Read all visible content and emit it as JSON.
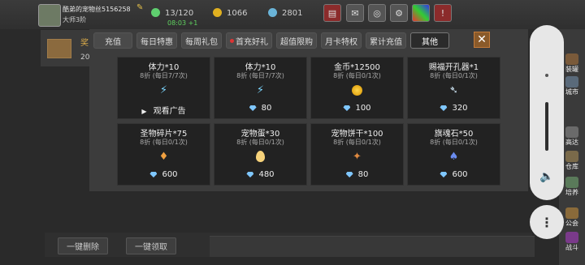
{
  "header": {
    "player_name": "酷弟的宠物丝5156258",
    "rank": "大师3阶",
    "stats": [
      {
        "icon": "stamina-icon",
        "value": "13/120",
        "color": "#5fcf6f"
      },
      {
        "icon": "gold-icon",
        "value": "1066",
        "color": "#e0b020"
      },
      {
        "icon": "gem-icon",
        "value": "2801",
        "color": "#6ab4d8"
      }
    ],
    "timer": "08:03 +1"
  },
  "side": {
    "label": "奖",
    "count": "20"
  },
  "tabs": [
    {
      "label": "充值",
      "active": false,
      "badge": false
    },
    {
      "label": "每日特惠",
      "active": false,
      "badge": false
    },
    {
      "label": "每周礼包",
      "active": false,
      "badge": false
    },
    {
      "label": "首充好礼",
      "active": false,
      "badge": true
    },
    {
      "label": "超值限购",
      "active": false,
      "badge": false
    },
    {
      "label": "月卡特权",
      "active": false,
      "badge": false
    },
    {
      "label": "累计充值",
      "active": false,
      "badge": false
    },
    {
      "label": "其他",
      "active": true,
      "badge": false
    }
  ],
  "close_label": "✕",
  "items": [
    {
      "title": "体力*10",
      "sub": "8折 (每日7/7次)",
      "icon": "lightning-icon",
      "price": "观看广告",
      "price_type": "ad"
    },
    {
      "title": "体力*10",
      "sub": "8折 (每日7/7次)",
      "icon": "lightning-icon",
      "price": "80",
      "price_type": "diamond"
    },
    {
      "title": "金币*12500",
      "sub": "8折 (每日0/1次)",
      "icon": "coin-icon",
      "price": "100",
      "price_type": "diamond"
    },
    {
      "title": "赐福开孔器*1",
      "sub": "8折 (每日0/1次)",
      "icon": "drill-icon",
      "price": "320",
      "price_type": "diamond"
    },
    {
      "title": "圣物碎片*75",
      "sub": "8折 (每日0/1次)",
      "icon": "shard-icon",
      "price": "600",
      "price_type": "diamond"
    },
    {
      "title": "宠物蛋*30",
      "sub": "8折 (每日0/1次)",
      "icon": "egg-icon",
      "price": "480",
      "price_type": "diamond"
    },
    {
      "title": "宠物饼干*100",
      "sub": "8折 (每日0/1次)",
      "icon": "bone-icon",
      "price": "80",
      "price_type": "diamond"
    },
    {
      "title": "旗魂石*50",
      "sub": "8折 (每日0/1次)",
      "icon": "stone-icon",
      "price": "600",
      "price_type": "diamond"
    }
  ],
  "bottom": {
    "delete_all": "一键删除",
    "collect_all": "一键领取"
  },
  "right_menu": [
    "装罐",
    "城市",
    "高达",
    "仓库",
    "培养",
    "公会",
    "战斗"
  ]
}
